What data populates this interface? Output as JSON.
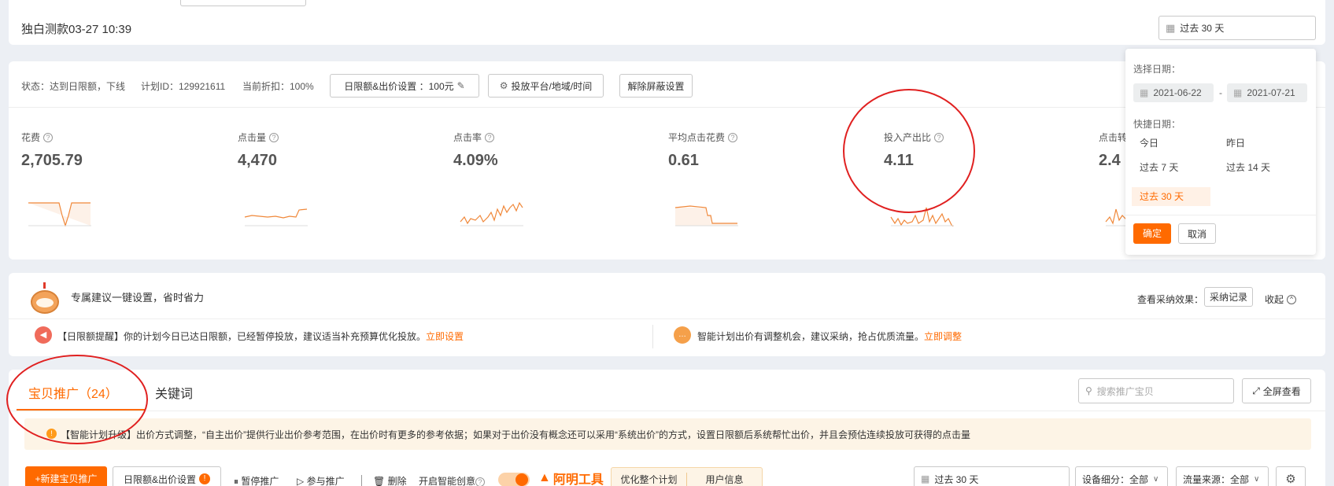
{
  "top": {
    "campaign_title": "独白测款03-27 10:39",
    "date_range": "过去 30 天"
  },
  "info_bar": {
    "status": "状态：达到日限额，下线",
    "plan_id": "计划ID：129921611",
    "discount": "当前折扣：100%",
    "budget_button": "日限额&出价设置 ：100元",
    "platform_button": "投放平台/地域/时间",
    "unblock_button": "解除屏蔽设置"
  },
  "metrics": [
    {
      "label": "花费",
      "value": "2,705.79"
    },
    {
      "label": "点击量",
      "value": "4,470"
    },
    {
      "label": "点击率",
      "value": "4.09%"
    },
    {
      "label": "平均点击花费",
      "value": "0.61"
    },
    {
      "label": "投入产出比",
      "value": "4.11"
    },
    {
      "label": "点击转",
      "value": "2.4"
    }
  ],
  "date_picker": {
    "select_label": "选择日期：",
    "start_date": "2021-06-22",
    "separator": "-",
    "end_date": "2021-07-21",
    "quick_label": "快捷日期：",
    "quick_options": [
      "今日",
      "昨日",
      "过去 7 天",
      "过去 14 天",
      "过去 30 天"
    ],
    "selected_option": "过去 30 天",
    "confirm": "确定",
    "cancel": "取消"
  },
  "suggestion": {
    "title": "专属建议一键设置，省时省力",
    "view_effect": "查看采纳效果：",
    "adopt_record": "采纳记录",
    "collapse": "收起",
    "alert1_text": "【日限额提醒】你的计划今日已达日限额，已经暂停投放，建议适当补充预算优化投放。",
    "alert1_link": "立即设置",
    "alert2_text": "智能计划出价有调整机会，建议采纳，抢占优质流量。",
    "alert2_link": "立即调整"
  },
  "tabs": {
    "items": [
      "宝贝推广（24）",
      "关键词"
    ],
    "active": 0,
    "search_placeholder": "搜索推广宝贝",
    "fullscreen": "全屏查看"
  },
  "notice": {
    "text": "【智能计划升级】出价方式调整，“自主出价”提供行业出价参考范围，在出价时有更多的参考依据；如果对于出价没有概念还可以采用“系统出价”的方式，设置日限额后系统帮忙出价，并且会预估连续投放可获得的点击量"
  },
  "toolbar": {
    "new_item": "+新建宝贝推广",
    "budget": "日限额&出价设置",
    "pause": "暂停推广",
    "join": "参与推广",
    "delete": "删除",
    "smart_creative": "开启智能创意",
    "logo_text": "阿明工具",
    "optimize_plan": "优化整个计划",
    "user_info": "用户信息",
    "date_range": "过去 30 天",
    "device": "设备细分：全部",
    "traffic": "流量来源：全部"
  },
  "colors": {
    "accent": "#ff6a00",
    "annotation_circle": "#e02020",
    "sparkline": "#f0883a"
  }
}
